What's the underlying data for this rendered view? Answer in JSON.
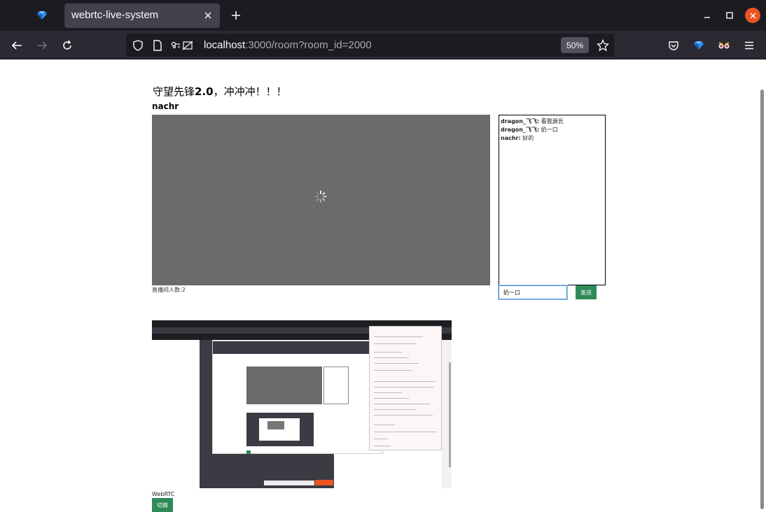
{
  "browser": {
    "tab_title": "webrtc-live-system",
    "url_host": "localhost",
    "url_rest": ":3000/room?room_id=2000",
    "zoom": "50%"
  },
  "room": {
    "title_prefix": "守望先锋",
    "title_version": "2.0",
    "title_suffix": "，冲冲冲！！！",
    "anchor_name": "nachr",
    "viewers_label": "直播间人数:2"
  },
  "chat": {
    "messages": [
      {
        "user": "dragon_飞飞:",
        "text": " 看我源氏"
      },
      {
        "user": "dragon_飞飞:",
        "text": " 奶一口"
      },
      {
        "user": "nachr:",
        "text": " 好的"
      }
    ],
    "input_value": "奶一口",
    "send_label": "发送"
  },
  "share": {
    "label": "WebRTC",
    "switch_label": "切换"
  },
  "colors": {
    "accent_green": "#2e8b57",
    "ubuntu_orange": "#e95420",
    "video_grey": "#6b6b6b"
  },
  "icons": [
    "sapphire-icon",
    "close-icon",
    "plus-icon",
    "minimize-icon",
    "maximize-icon",
    "back-arrow-icon",
    "forward-arrow-icon",
    "reload-icon",
    "shield-icon",
    "page-icon",
    "permissions-icon",
    "star-icon",
    "pocket-icon",
    "extension-icon",
    "menu-icon",
    "spinner-icon"
  ]
}
